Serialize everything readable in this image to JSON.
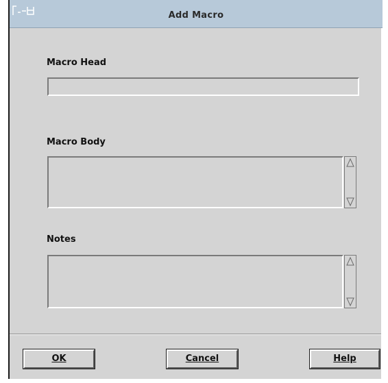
{
  "window": {
    "title": "Add Macro"
  },
  "fields": {
    "macro_head_label": "Macro Head",
    "macro_head_value": "",
    "macro_body_label": "Macro Body",
    "macro_body_value": "",
    "notes_label": "Notes",
    "notes_value": ""
  },
  "buttons": {
    "ok_label": "OK",
    "cancel_label": "Cancel",
    "help_label": "Help"
  },
  "colors": {
    "window_bg": "#d4d4d4",
    "titlebar_bg": "#b7c9d9"
  }
}
